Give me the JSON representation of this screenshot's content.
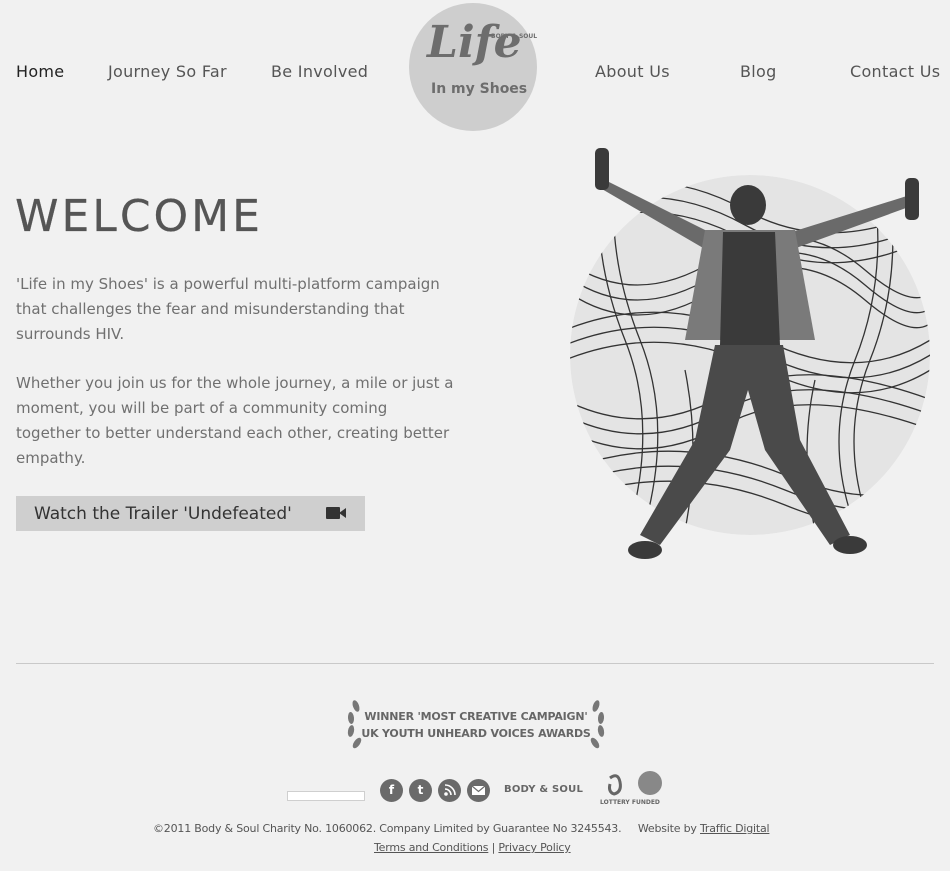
{
  "nav": {
    "items": [
      {
        "label": "Home"
      },
      {
        "label": "Journey So Far"
      },
      {
        "label": "Be Involved"
      },
      {
        "label": "About Us"
      },
      {
        "label": "Blog"
      },
      {
        "label": "Contact Us"
      }
    ]
  },
  "logo": {
    "word": "Life",
    "subtitle": "In my Shoes",
    "brand": "BODY & SOUL"
  },
  "main": {
    "heading": "WELCOME",
    "paragraph1": "'Life in my Shoes' is a powerful multi-platform campaign that challenges the fear and misunderstanding that surrounds HIV.",
    "paragraph2": "Whether you join us for the whole journey, a mile or just a moment, you will be part of a community coming together to better understand each other, creating better empathy.",
    "trailer_button": "Watch the Trailer 'Undefeated'"
  },
  "footer": {
    "award_line1": "WINNER 'MOST CREATIVE CAMPAIGN'",
    "award_line2": "UK YOUTH  UNHEARD VOICES AWARDS",
    "social": {
      "facebook": "f",
      "twitter": "t",
      "rss": "",
      "email": ""
    },
    "bodysoul_logo": "BODY & SOUL",
    "lottery_logo": "LOTTERY FUNDED",
    "copyright_text": "©2011 Body & Soul Charity No. 1060062. Company Limited by Guarantee No 3245543.",
    "website_by_label": "Website by",
    "website_by_link": "Traffic Digital",
    "terms_link": "Terms and Conditions",
    "separator": "|",
    "privacy_link": "Privacy Policy"
  },
  "colors": {
    "background": "#f1f1f1",
    "logo_circle": "#cecece",
    "button_bg": "#cfcfcf",
    "text": "#555555",
    "icon": "#6a6a6a"
  }
}
